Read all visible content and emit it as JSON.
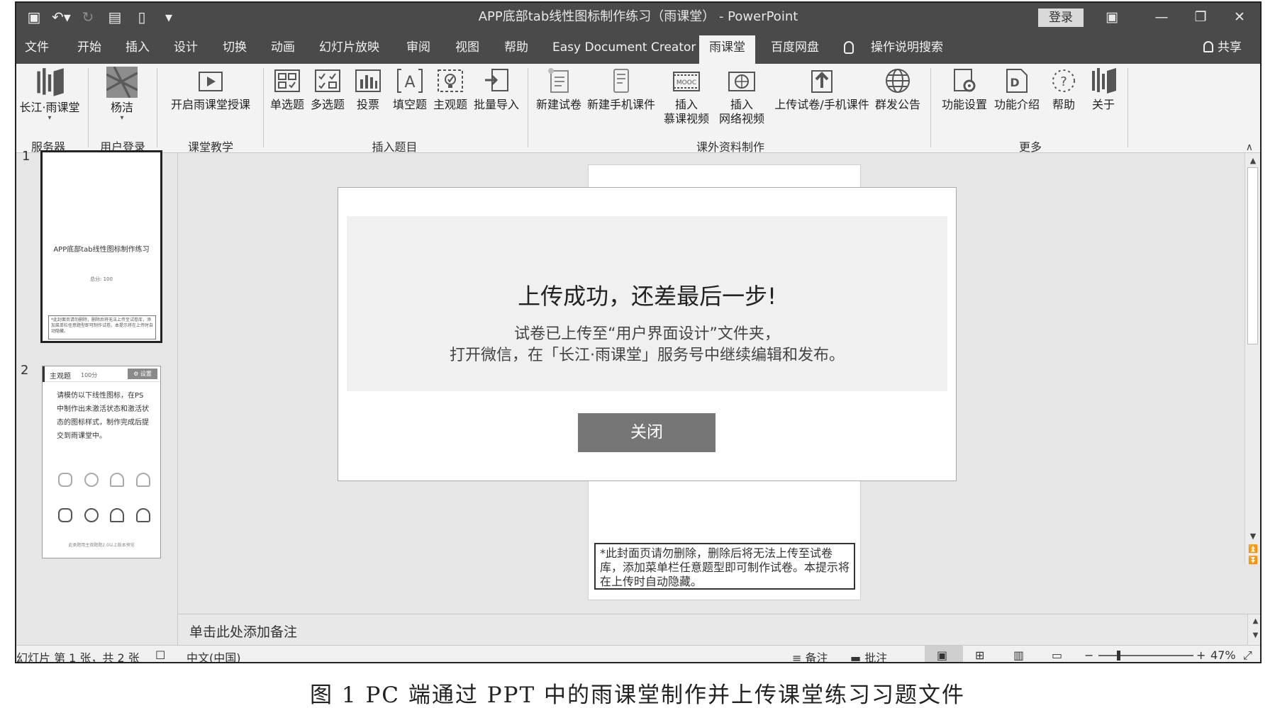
{
  "titlebar": {
    "title": "APP底部tab线性图标制作练习（雨课堂） - PowerPoint",
    "login": "登录",
    "qat": [
      "save-icon",
      "undo-icon",
      "redo-icon",
      "present-icon",
      "new-icon",
      "customize-icon"
    ]
  },
  "tabs": [
    "文件",
    "开始",
    "插入",
    "设计",
    "切换",
    "动画",
    "幻灯片放映",
    "审阅",
    "视图",
    "帮助",
    "Easy Document Creator",
    "雨课堂",
    "百度网盘"
  ],
  "active_tab": "雨课堂",
  "tell_me": "操作说明搜索",
  "share": "共享",
  "ribbon": {
    "groups": {
      "server": "服务器",
      "login": "用户登录",
      "class": "课堂教学",
      "insert": "插入题目",
      "extra": "课外资料制作",
      "more": "更多"
    },
    "buttons": {
      "changjiang": "长江·雨课堂",
      "user": "杨洁",
      "start_class": "开启雨课堂授课",
      "single": "单选题",
      "multi": "多选题",
      "vote": "投票",
      "fill": "填空题",
      "subjective": "主观题",
      "batch": "批量导入",
      "new_paper": "新建试卷",
      "new_mobile": "新建手机课件",
      "mooc_1": "插入",
      "mooc_2": "慕课视频",
      "web_1": "插入",
      "web_2": "网络视频",
      "upload": "上传试卷/手机课件",
      "announce": "群发公告",
      "settings": "功能设置",
      "intro": "功能介绍",
      "help": "帮助",
      "about": "关于"
    }
  },
  "thumbnails": {
    "slide1": {
      "number": "1",
      "title": "APP底部tab线性图标制作练习",
      "score": "总分: 100",
      "note": "*此封面页请勿删除，删除后将无法上传至试卷库，添加菜单栏任意题型即可制作试卷。本提示将在上传时自动隐藏。"
    },
    "slide2": {
      "number": "2",
      "type": "主观题",
      "score": "100分",
      "settings": "⚙ 设置",
      "body": "请模仿以下线性图标，在PS中制作出未激活状态和激活状态的图标样式，制作完成后提交到雨课堂中。",
      "footer": "此类题用主观题题2.0以上版本预览"
    }
  },
  "slide_note": "*此封面页请勿删除，删除后将无法上传至试卷库，添加菜单栏任意题型即可制作试卷。本提示将在上传时自动隐藏。",
  "dialog": {
    "title": "上传成功，还差最后一步!",
    "line1": "试卷已上传至“用户界面设计”文件夹，",
    "line2": "打开微信，在「长江·雨课堂」服务号中继续编辑和发布。",
    "close": "关闭"
  },
  "notes_placeholder": "单击此处添加备注",
  "status": {
    "slide": "幻灯片 第 1 张，共 2 张",
    "lang": "中文(中国)",
    "notes": "备注",
    "comments": "批注",
    "zoom": "47%",
    "zoom_value": 47
  },
  "caption": "图 1   PC 端通过 PPT 中的雨课堂制作并上传课堂练习习题文件"
}
